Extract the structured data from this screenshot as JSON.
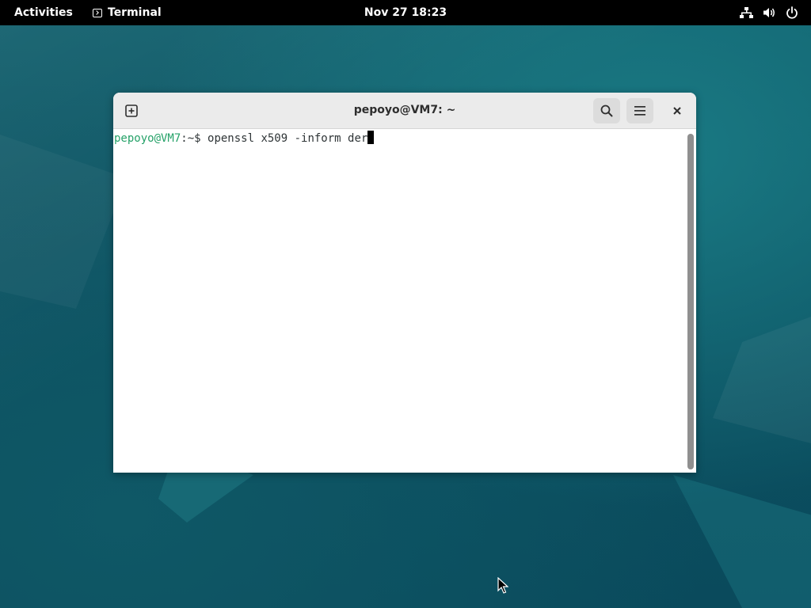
{
  "topbar": {
    "activities_label": "Activities",
    "app_menu_label": "Terminal",
    "clock": "Nov 27  18:23",
    "status_icons": [
      "network-icon",
      "volume-icon",
      "power-icon"
    ]
  },
  "window": {
    "title": "pepoyo@VM7: ~",
    "buttons": [
      "new-tab-icon",
      "search-icon",
      "hamburger-menu-icon",
      "close-icon"
    ]
  },
  "terminal": {
    "prompt_user_host": "pepoyo@VM7",
    "prompt_suffix": ":~$ ",
    "command": "openssl x509 -inform der"
  },
  "colors": {
    "prompt_green": "#26a269",
    "desktop_teal": "#0c5262"
  }
}
